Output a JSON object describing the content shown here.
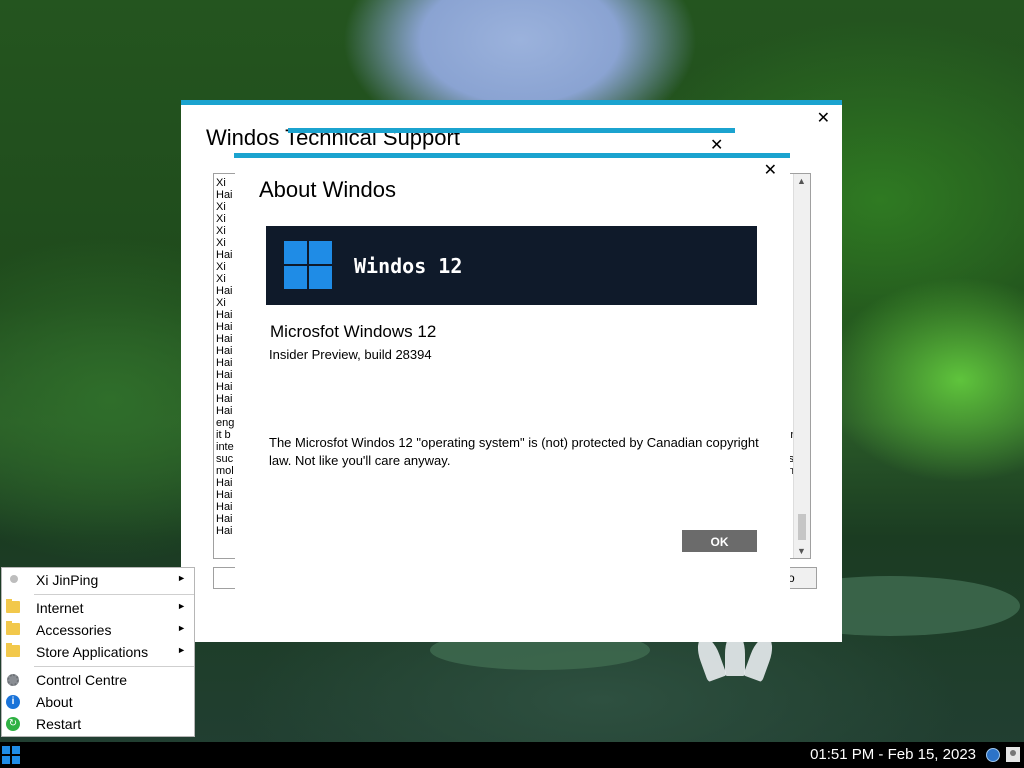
{
  "background_window": {
    "title": "Windos Technical Support",
    "close_label": "✕",
    "log_lines": [
      "Xi",
      "Hai",
      "Xi",
      "Xi",
      "Xi",
      "Xi",
      "Hai",
      "Xi",
      "Xi",
      "Hai",
      "Xi",
      "Hai",
      "Hai",
      "Hai",
      "Hai",
      "Hai",
      "Hai",
      "Hai",
      "Hai",
      "Hai",
      "eng",
      "it b",
      "inte",
      "suc",
      "mol",
      "Hai",
      "Hai",
      "Hai",
      "Hai",
      "Hai"
    ],
    "log_right_fragments": [
      "r",
      "",
      "s",
      "n"
    ],
    "button_label": "o"
  },
  "middle_window": {
    "close_label": "✕"
  },
  "about_dialog": {
    "title": "About Windos",
    "close_label": "✕",
    "banner_text": "Windos 12",
    "product_name": "Microsfot Windows 12",
    "build_text": "Insider Preview, build 28394",
    "legal_text": "The Microsfot Windos 12 \"operating system\" is (not) protected by Canadian copyright law. Not like you'll care anyway.",
    "ok_label": "OK"
  },
  "start_menu": {
    "items": [
      {
        "label": "Xi JinPing",
        "icon": "user-icon",
        "submenu": true
      },
      {
        "label": "Internet",
        "icon": "folder-icon",
        "submenu": true
      },
      {
        "label": "Accessories",
        "icon": "folder-icon",
        "submenu": true
      },
      {
        "label": "Store Applications",
        "icon": "folder-icon",
        "submenu": true
      },
      {
        "label": "Control Centre",
        "icon": "gear-icon",
        "submenu": false
      },
      {
        "label": "About",
        "icon": "info-icon",
        "submenu": false
      },
      {
        "label": "Restart",
        "icon": "restart-icon",
        "submenu": false
      }
    ],
    "arrow_glyph": "►",
    "info_glyph": "i",
    "restart_glyph": "↻"
  },
  "taskbar": {
    "clock": "01:51 PM - Feb 15, 2023"
  },
  "colors": {
    "accent": "#1ba3cf",
    "logo_blue": "#1f8ce6",
    "banner_bg": "#0f1a2a",
    "ok_button": "#6b6b6b"
  }
}
